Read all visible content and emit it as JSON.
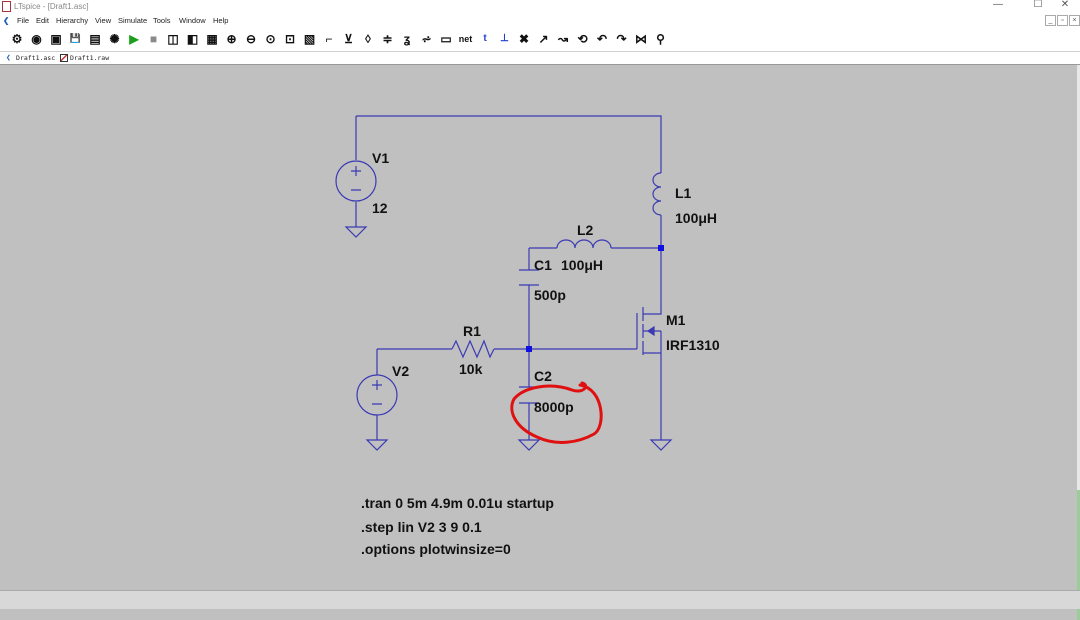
{
  "window": {
    "title": "LTspice - [Draft1.asc]",
    "controls": [
      "—",
      "☐",
      "✕"
    ]
  },
  "menu": {
    "items": [
      "File",
      "Edit",
      "Hierarchy",
      "View",
      "Simulate",
      "Tools",
      "Window",
      "Help"
    ]
  },
  "toolbar": {
    "icons": [
      "gear-icon",
      "open-icon",
      "open-folder-icon",
      "save-icon",
      "print-icon",
      "control-panel-icon",
      "run-icon",
      "stop-icon",
      "tile-vertical-icon",
      "tile-horizontal-icon",
      "cascade-icon",
      "zoom-in-icon",
      "zoom-out-icon",
      "zoom-fit-icon",
      "zoom-area-icon",
      "autorange-icon",
      "wire-icon",
      "ground-icon",
      "label-icon",
      "resistor-icon",
      "capacitor-icon",
      "inductor-icon",
      "diode-icon",
      "component-icon",
      "spice-directive-icon",
      "text-icon",
      "cut-icon",
      "move-icon",
      "drag-icon",
      "undo-icon",
      "redo-icon",
      "rotate-icon",
      "mirror-icon",
      "find-icon"
    ],
    "glyphs": [
      "⚙",
      "◉",
      "▣",
      "💾",
      "▤",
      "✺",
      "▶",
      "■",
      "◫",
      "◧",
      "▦",
      "⊕",
      "⊖",
      "⊙",
      "⊡",
      "▧",
      "⌐",
      "⊻",
      "◊",
      "≑",
      "ʓ",
      "⩫",
      "▭",
      "net",
      "t",
      "⊥",
      "✖",
      "↗",
      "↝",
      "⟲",
      "↶",
      "↷",
      "⋈",
      "⚲"
    ]
  },
  "tabs": [
    {
      "label": "Draft1.asc",
      "icon": "schematic-icon"
    },
    {
      "label": "Draft1.raw",
      "icon": "waveform-icon"
    }
  ],
  "schematic": {
    "components": {
      "V1": {
        "name": "V1",
        "value": "12"
      },
      "V2": {
        "name": "V2"
      },
      "L1": {
        "name": "L1",
        "value": "100μH"
      },
      "L2": {
        "name": "L2",
        "value": "100μH"
      },
      "C1": {
        "name": "C1",
        "value": "500p"
      },
      "C2": {
        "name": "C2",
        "value": "8000p"
      },
      "R1": {
        "name": "R1",
        "value": "10k"
      },
      "M1": {
        "name": "M1",
        "value": "IRF1310"
      }
    },
    "directives": [
      ".tran 0 5m 4.9m 0.01u startup",
      ".step lin V2 3 9 0.1",
      ".options plotwinsize=0"
    ],
    "wire_color": "#3a3ab4",
    "annotation_color": "#e01010"
  }
}
